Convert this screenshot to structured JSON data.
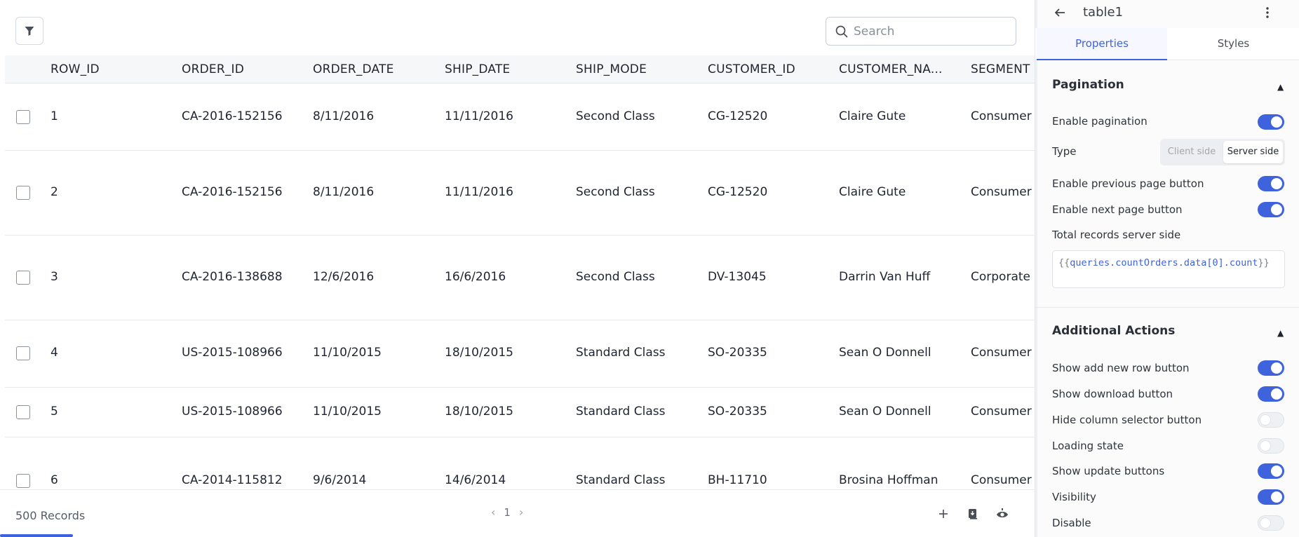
{
  "toolbar": {
    "search_placeholder": "Search"
  },
  "table": {
    "columns": [
      "ROW_ID",
      "ORDER_ID",
      "ORDER_DATE",
      "SHIP_DATE",
      "SHIP_MODE",
      "CUSTOMER_ID",
      "CUSTOMER_NA...",
      "SEGMENT"
    ],
    "rows": [
      [
        "1",
        "CA-2016-152156",
        "8/11/2016",
        "11/11/2016",
        "Second Class",
        "CG-12520",
        "Claire Gute",
        "Consumer"
      ],
      [
        "2",
        "CA-2016-152156",
        "8/11/2016",
        "11/11/2016",
        "Second Class",
        "CG-12520",
        "Claire Gute",
        "Consumer"
      ],
      [
        "3",
        "CA-2016-138688",
        "12/6/2016",
        "16/6/2016",
        "Second Class",
        "DV-13045",
        "Darrin Van Huff",
        "Corporate"
      ],
      [
        "4",
        "US-2015-108966",
        "11/10/2015",
        "18/10/2015",
        "Standard Class",
        "SO-20335",
        "Sean O Donnell",
        "Consumer"
      ],
      [
        "5",
        "US-2015-108966",
        "11/10/2015",
        "18/10/2015",
        "Standard Class",
        "SO-20335",
        "Sean O Donnell",
        "Consumer"
      ],
      [
        "6",
        "CA-2014-115812",
        "9/6/2014",
        "14/6/2014",
        "Standard Class",
        "BH-11710",
        "Brosina Hoffman",
        "Consumer"
      ]
    ]
  },
  "footer": {
    "records": "500 Records",
    "page": "1",
    "prev": "‹",
    "next": "›"
  },
  "panel": {
    "title": "table1",
    "tabs": [
      "Properties",
      "Styles"
    ],
    "active_tab": "Properties",
    "pagination": {
      "title": "Pagination",
      "enable_pagination": {
        "label": "Enable pagination",
        "on": true
      },
      "type": {
        "label": "Type",
        "options": [
          "Client side",
          "Server side"
        ],
        "selected": "Server side"
      },
      "enable_prev": {
        "label": "Enable previous page button",
        "on": true
      },
      "enable_next": {
        "label": "Enable next page button",
        "on": true
      },
      "total_records_label": "Total records server side",
      "total_records_value": "{{queries.countOrders.data[0].count}}"
    },
    "additional_actions": {
      "title": "Additional Actions",
      "items": [
        {
          "label": "Show add new row button",
          "on": true
        },
        {
          "label": "Show download button",
          "on": true
        },
        {
          "label": "Hide column selector button",
          "on": false
        },
        {
          "label": "Loading state",
          "on": false
        },
        {
          "label": "Show update buttons",
          "on": true
        },
        {
          "label": "Visibility",
          "on": true
        },
        {
          "label": "Disable",
          "on": false
        }
      ]
    }
  },
  "colors": {
    "accent": "#3e63dd",
    "toggle_off": "#eef0f3",
    "code_text": "#6b49b8"
  }
}
